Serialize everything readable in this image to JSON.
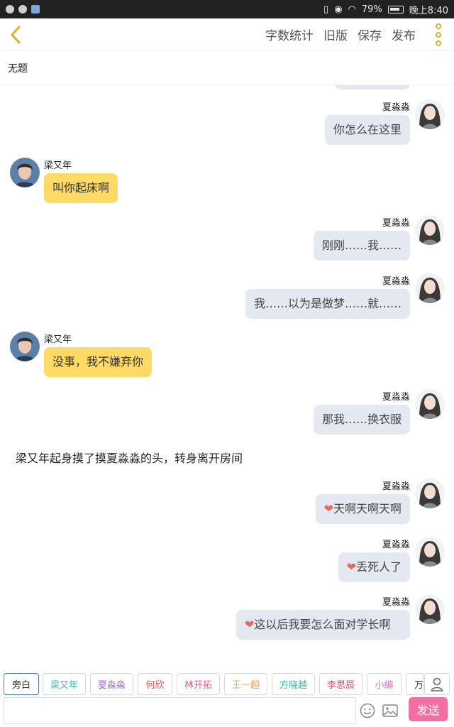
{
  "status_bar": {
    "battery": "79%",
    "time": "晚上8:40"
  },
  "toolbar": {
    "word_count": "字数统计",
    "old_version": "旧版",
    "save": "保存",
    "publish": "发布"
  },
  "document": {
    "title": "无题"
  },
  "messages": [
    {
      "speaker": "夏淼淼",
      "text": "你怎么在这里"
    },
    {
      "speaker": "梁又年",
      "text": "叫你起床啊"
    },
    {
      "speaker": "夏淼淼",
      "text": "刚刚……我……"
    },
    {
      "speaker": "夏淼淼",
      "text": "我……以为是做梦……就……"
    },
    {
      "speaker": "梁又年",
      "text": "没事，我不嫌弃你"
    },
    {
      "speaker": "夏淼淼",
      "text": "那我……换衣服"
    },
    {
      "narration": "梁又年起身摸了摸夏淼淼的头，转身离开房间"
    },
    {
      "speaker": "夏淼淼",
      "text": "天啊天啊天啊"
    },
    {
      "speaker": "夏淼淼",
      "text": "丢死人了"
    },
    {
      "speaker": "夏淼淼",
      "text": "这以后我要怎么面对学长啊"
    }
  ],
  "characters": [
    {
      "name": "旁白",
      "color": "#333333"
    },
    {
      "name": "梁又年",
      "color": "#3bb8b0"
    },
    {
      "name": "夏淼淼",
      "color": "#9b6fd0"
    },
    {
      "name": "何欣",
      "color": "#e05a5a"
    },
    {
      "name": "林开拓",
      "color": "#e0578a"
    },
    {
      "name": "王一超",
      "color": "#f0a35a"
    },
    {
      "name": "方晓越",
      "color": "#3bb8b0"
    },
    {
      "name": "李思辰",
      "color": "#d64a7a"
    },
    {
      "name": "小编",
      "color": "#e070c0"
    },
    {
      "name": "万",
      "color": "#333333"
    }
  ],
  "input": {
    "value": "",
    "send_label": "发送"
  },
  "colors": {
    "accent": "#d4b32a",
    "send": "#f06fa4",
    "bubble_right": "#e4e8f0",
    "bubble_left": "#fdd966",
    "heart": "#e06a6a"
  }
}
